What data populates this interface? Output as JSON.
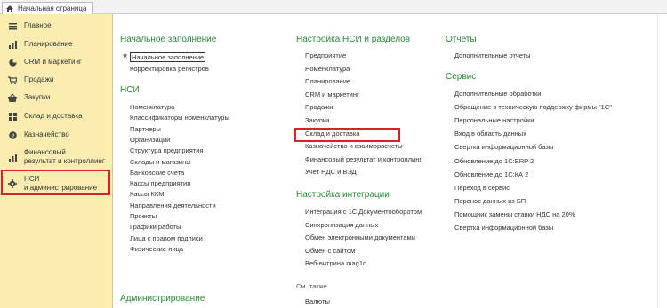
{
  "tab": {
    "label": "Начальная страница"
  },
  "sidebar": {
    "items": [
      {
        "label": "Главное",
        "icon": "menu-icon"
      },
      {
        "label": "Планирование",
        "icon": "chart-icon"
      },
      {
        "label": "CRM и маркетинг",
        "icon": "pie-icon"
      },
      {
        "label": "Продажи",
        "icon": "cart-icon"
      },
      {
        "label": "Закупки",
        "icon": "basket-icon"
      },
      {
        "label": "Склад и доставка",
        "icon": "warehouse-icon"
      },
      {
        "label": "Казначейство",
        "icon": "coin-icon"
      },
      {
        "label": "Финансовый",
        "label2": "результат и контроллинг",
        "icon": "finance-icon"
      },
      {
        "label": "НСИ",
        "label2": "и администрирование",
        "icon": "gear-icon"
      }
    ]
  },
  "col1": {
    "initial_title": "Начальное заполнение",
    "initial_items": [
      "Начальное заполнение",
      "Корректировка регистров"
    ],
    "nsi_title": "НСИ",
    "nsi_items": [
      "Номенклатура",
      "Классификаторы номенклатуры",
      "Партнеры",
      "Организации",
      "Структура предприятия",
      "Склады и магазины",
      "Банковские счета",
      "Кассы предприятия",
      "Кассы ККМ",
      "Направления деятельности",
      "Проекты",
      "Графики работы",
      "Лица с правом подписи",
      "Физические лица"
    ],
    "admin_title": "Администрирование"
  },
  "col2": {
    "settings_title": "Настройка НСИ и разделов",
    "settings_items": [
      "Предприятие",
      "Номенклатура",
      "Планирование",
      "CRM и маркетинг",
      "Продажи",
      "Закупки",
      "Склад и доставка",
      "Казначейство и взаиморасчеты",
      "Финансовый результат и контроллинг",
      "Учет НДС и ВЭД"
    ],
    "integration_title": "Настройка интеграции",
    "integration_items": [
      "Интеграция с 1С:Документооборотом",
      "Синхронизация данных",
      "Обмен электронными документами",
      "Обмен с сайтом",
      "Веб-витрина mag1c"
    ],
    "see_also": "См. также",
    "see_items": [
      "Валюты"
    ]
  },
  "col3": {
    "reports_title": "Отчеты",
    "reports_items": [
      "Дополнительные отчеты"
    ],
    "service_title": "Сервис",
    "service_items": [
      "Дополнительные обработки",
      "Обращение в техническую поддержку фирмы \"1С\"",
      "Персональные настройки",
      "Вход в область данных",
      "Свертка информационной базы",
      "Обновление до 1С:ERP 2",
      "Обновление до 1С:КА 2",
      "Переход в сервис",
      "Перенос данных из БП",
      "Помощник замены ставки НДС на 20%",
      "Свертка информационной базы"
    ]
  },
  "colors": {
    "accent": "#2a8a3a",
    "sidebar_bg": "#fbedb0",
    "highlight": "#d8222a"
  }
}
